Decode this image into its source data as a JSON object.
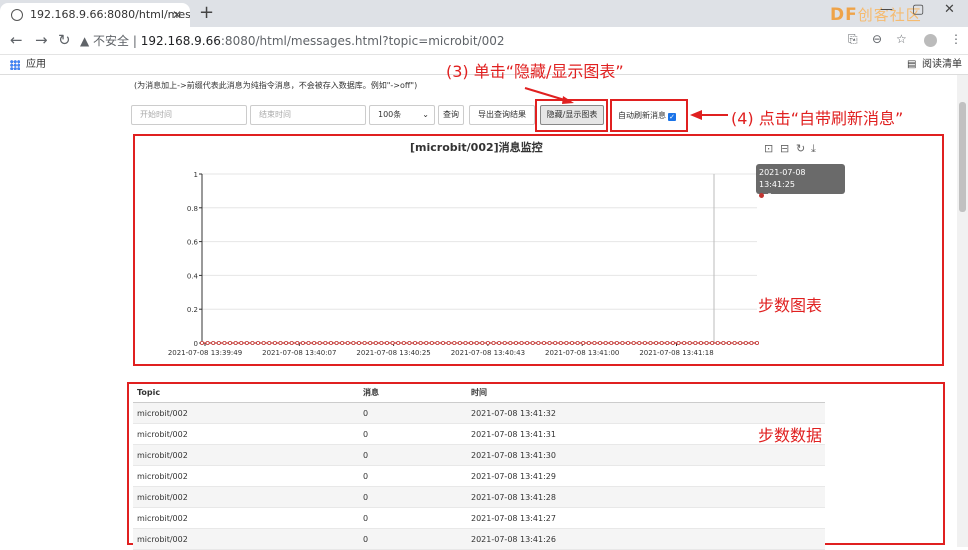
{
  "browser": {
    "tab_title": "192.168.9.66:8080/html/messa",
    "url_warning": "不安全",
    "url_host": "192.168.9.66",
    "url_rest": ":8080/html/messages.html?topic=microbit/002",
    "bookmark_apps": "应用",
    "reading_list": "阅读清单",
    "logo_text": "DF",
    "logo_cn": "创客社区"
  },
  "page": {
    "hint": "(为消息加上->前缀代表此消息为纯指令消息，不会被存入数据库。例如\"->off\")",
    "start_placeholder": "开始时间",
    "end_placeholder": "结束时间",
    "count_select": "100条",
    "query_button": "查询",
    "export_button": "导出查询结果",
    "toggle_chart_button": "隐藏/显示图表",
    "auto_refresh_label": "自动刷新消息"
  },
  "annotations": {
    "step3": "(3) 单击“隐藏/显示图表”",
    "step4": "(4) 点击“自带刷新消息”",
    "chart_label": "步数图表",
    "data_label": "步数数据"
  },
  "chart_data": {
    "type": "line",
    "title": "[microbit/002]消息监控",
    "x_ticks": [
      "2021-07-08 13:39:49",
      "2021-07-08 13:40:07",
      "2021-07-08 13:40:25",
      "2021-07-08 13:40:43",
      "2021-07-08 13:41:00",
      "2021-07-08 13:41:18"
    ],
    "y_ticks": [
      "0",
      "0.2",
      "0.4",
      "0.6",
      "0.8",
      "1"
    ],
    "ylim": [
      0,
      1
    ],
    "series": [
      {
        "values": [
          0,
          0,
          0,
          0,
          0,
          0,
          0,
          0,
          0,
          0,
          0,
          0,
          0,
          0,
          0,
          0,
          0,
          0,
          0,
          0,
          0,
          0,
          0,
          0,
          0,
          0,
          0,
          0,
          0,
          0,
          0,
          0,
          0,
          0,
          0,
          0,
          0,
          0,
          0,
          0,
          0,
          0,
          0,
          0,
          0,
          0,
          0,
          0,
          0,
          0,
          0,
          0,
          0,
          0,
          0,
          0,
          0,
          0,
          0,
          0,
          0,
          0,
          0,
          0,
          0,
          0,
          0,
          0,
          0,
          0,
          0,
          0,
          0,
          0,
          0,
          0,
          0,
          0,
          0,
          0,
          0,
          0,
          0,
          0,
          0,
          0,
          0,
          0,
          0,
          0,
          0,
          0,
          0,
          0,
          0,
          0,
          0,
          0,
          0,
          0
        ],
        "color": "#c23531"
      }
    ],
    "tooltip": {
      "time": "2021-07-08 13:41:25",
      "value": "0"
    },
    "grid": true
  },
  "table": {
    "headers": [
      "Topic",
      "消息",
      "时间"
    ],
    "rows": [
      [
        "microbit/002",
        "0",
        "2021-07-08 13:41:32"
      ],
      [
        "microbit/002",
        "0",
        "2021-07-08 13:41:31"
      ],
      [
        "microbit/002",
        "0",
        "2021-07-08 13:41:30"
      ],
      [
        "microbit/002",
        "0",
        "2021-07-08 13:41:29"
      ],
      [
        "microbit/002",
        "0",
        "2021-07-08 13:41:28"
      ],
      [
        "microbit/002",
        "0",
        "2021-07-08 13:41:27"
      ],
      [
        "microbit/002",
        "0",
        "2021-07-08 13:41:26"
      ]
    ]
  }
}
